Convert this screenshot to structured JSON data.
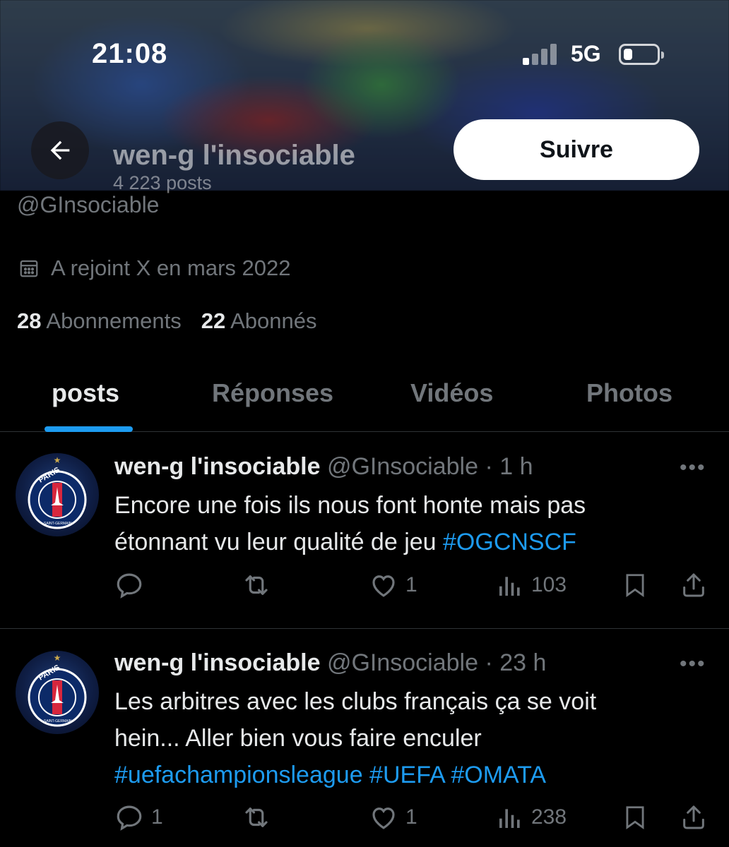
{
  "status_bar": {
    "time": "21:08",
    "network": "5G"
  },
  "header": {
    "name": "wen-g l'insociable",
    "post_count": "4 223 posts",
    "follow_label": "Suivre"
  },
  "profile": {
    "handle": "@GInsociable",
    "joined": "A rejoint X en mars 2022",
    "following_count": "28",
    "following_label": "Abonnements",
    "followers_count": "22",
    "followers_label": "Abonnés"
  },
  "tabs": [
    {
      "label": "posts",
      "active": true
    },
    {
      "label": "Réponses",
      "active": false
    },
    {
      "label": "Vidéos",
      "active": false
    },
    {
      "label": "Photos",
      "active": false
    }
  ],
  "posts": [
    {
      "name": "wen-g l'insociable",
      "handle": "@GInsociable",
      "time": "· 1 h",
      "text_line1": "Encore une fois ils nous font honte mais pas",
      "text_line2_plain": "étonnant vu leur qualité de jeu ",
      "text_line2_tag": "#OGCNSCF",
      "replies": "",
      "reposts": "",
      "likes": "1",
      "views": "103"
    },
    {
      "name": "wen-g l'insociable",
      "handle": "@GInsociable",
      "time": "· 23 h",
      "text_line1": "Les arbitres avec les clubs français ça se voit",
      "text_line2_plain": "hein... Aller bien vous faire enculer",
      "text_line3_tag": "#uefachampionsleague #UEFA #OMATA",
      "replies": "1",
      "reposts": "",
      "likes": "1",
      "views": "238"
    }
  ],
  "avatar_badge": {
    "top": "PARIS",
    "bottom": "SAINT-GERMAIN"
  },
  "icons": [
    "back-arrow-icon",
    "calendar-icon",
    "reply-icon",
    "repost-icon",
    "like-icon",
    "views-icon",
    "bookmark-icon",
    "share-icon",
    "more-icon"
  ],
  "colors": {
    "accent": "#1d9bf0",
    "muted": "#71767b",
    "text": "#e7e9ea",
    "background": "#000000"
  }
}
